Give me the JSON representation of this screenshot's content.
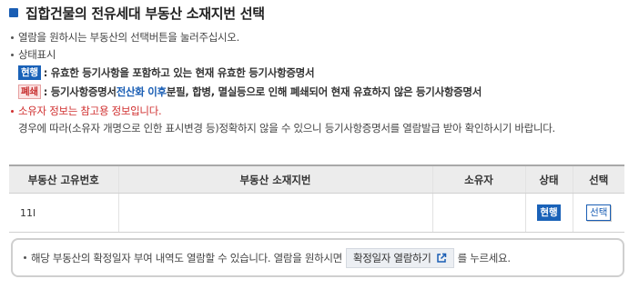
{
  "header": {
    "title": "집합건물의 전유세대 부동산 소재지번 선택"
  },
  "guide": {
    "line1": "열람을 원하시는 부동산의 선택버튼을 눌러주십시오.",
    "status_heading": "상태표시",
    "current_badge": "현행",
    "current_desc": ": 유효한 등기사항을 포함하고 있는 현재 유효한 등기사항증명서",
    "closed_badge": "폐쇄",
    "closed_desc_a": ": 등기사항증명서 ",
    "closed_desc_highlight": "전산화 이후",
    "closed_desc_b": " 분필, 합병, 멸실등으로 인해 폐쇄되어 현재 유효하지 않은 등기사항증명서",
    "owner_notice": "소유자 정보는 참고용 정보입니다.",
    "owner_notice_body": "경우에 따라(소유자 개명으로 인한 표시변경 등)정확하지 않을 수 있으니 등기사항증명서를 열람발급 받아 확인하시기 바랍니다."
  },
  "table": {
    "headers": [
      "부동산 고유번호",
      "부동산 소재지번",
      "소유자",
      "상태",
      "선택"
    ],
    "rows": [
      {
        "id": "11l",
        "address": "",
        "owner": "",
        "status": "현행",
        "select_label": "선택"
      }
    ]
  },
  "info": {
    "text_before": "해당 부동산의 확정일자 부여 내역도 열람할 수 있습니다. 열람을 원하시면",
    "button_label": "확정일자 열람하기",
    "button_icon": "external-link-icon",
    "text_after": "를 누르세요."
  },
  "colors": {
    "accent": "#1a5eb4",
    "current_badge": "#1a62b8",
    "closed_badge_text": "#c83333",
    "owner_notice": "#d03030"
  }
}
